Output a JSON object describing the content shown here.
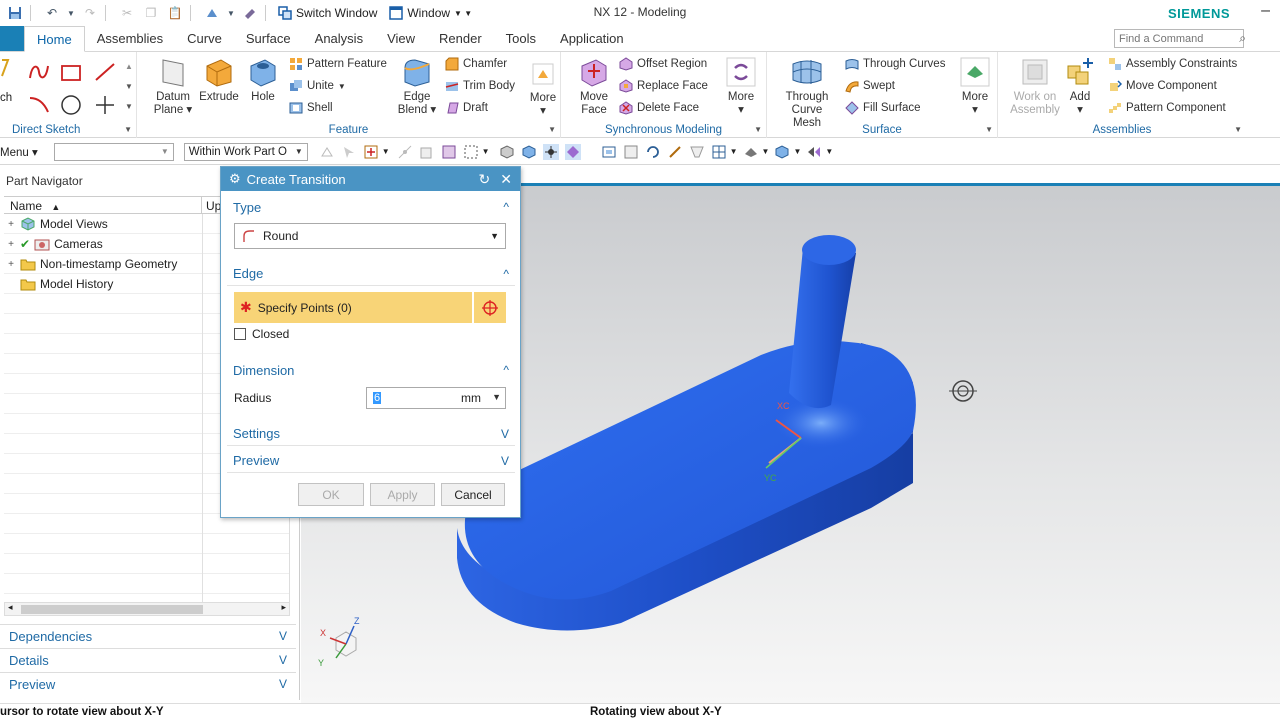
{
  "window": {
    "title": "NX 12 - Modeling",
    "brand": "SIEMENS",
    "switch_window": "Switch Window",
    "window_menu": "Window"
  },
  "tabs": [
    {
      "label": "Home",
      "active": true
    },
    {
      "label": "Assemblies"
    },
    {
      "label": "Curve"
    },
    {
      "label": "Surface"
    },
    {
      "label": "Analysis"
    },
    {
      "label": "View"
    },
    {
      "label": "Render"
    },
    {
      "label": "Tools"
    },
    {
      "label": "Application"
    }
  ],
  "search": {
    "placeholder": "Find a Command"
  },
  "ribbon": {
    "direct_sketch": {
      "label": "Direct Sketch",
      "sketch_label": "ch"
    },
    "feature": {
      "label": "Feature",
      "datum_plane": "Datum Plane",
      "extrude": "Extrude",
      "hole": "Hole",
      "pattern_feature": "Pattern Feature",
      "unite": "Unite",
      "shell": "Shell",
      "edge_blend": "Edge Blend",
      "chamfer": "Chamfer",
      "trim_body": "Trim Body",
      "draft": "Draft",
      "more": "More"
    },
    "sync": {
      "label": "Synchronous Modeling",
      "move_face": "Move Face",
      "offset_region": "Offset Region",
      "replace_face": "Replace Face",
      "delete_face": "Delete Face",
      "more": "More"
    },
    "surface": {
      "label": "Surface",
      "through_curve_mesh": "Through Curve Mesh",
      "through_curves": "Through Curves",
      "swept": "Swept",
      "fill_surface": "Fill Surface",
      "more": "More"
    },
    "assemblies": {
      "label": "Assemblies",
      "work_on_assembly": "Work on Assembly",
      "add": "Add",
      "assembly_constraints": "Assembly Constraints",
      "move_component": "Move Component",
      "pattern_component": "Pattern Component"
    }
  },
  "toolbar2": {
    "menu": "Menu",
    "filter_value": "",
    "scope": "Within Work Part O"
  },
  "partnav": {
    "title": "Part Navigator",
    "col_name": "Name",
    "col_up": "Up",
    "items": [
      {
        "label": "Model Views"
      },
      {
        "label": "Cameras"
      },
      {
        "label": "Non-timestamp Geometry"
      },
      {
        "label": "Model History"
      }
    ],
    "panels": [
      "Dependencies",
      "Details",
      "Preview"
    ]
  },
  "dialog": {
    "title": "Create Transition",
    "type_header": "Type",
    "type_value": "Round",
    "edge_header": "Edge",
    "specify_points": "Specify Points (0)",
    "closed": "Closed",
    "dimension_header": "Dimension",
    "radius_label": "Radius",
    "radius_value": "6",
    "radius_unit": "mm",
    "settings_header": "Settings",
    "preview_header": "Preview",
    "ok": "OK",
    "apply": "Apply",
    "cancel": "Cancel"
  },
  "graphics": {
    "triad_x": "X",
    "triad_y": "Y",
    "triad_z": "Z",
    "xc": "XC",
    "yc": "YC"
  },
  "status": {
    "left": "ursor to rotate view about X-Y",
    "center": "Rotating view about X-Y"
  },
  "colors": {
    "accent": "#1a80b6",
    "part_blue": "#2466e8",
    "highlight": "#f8d477",
    "brand": "#009999"
  }
}
